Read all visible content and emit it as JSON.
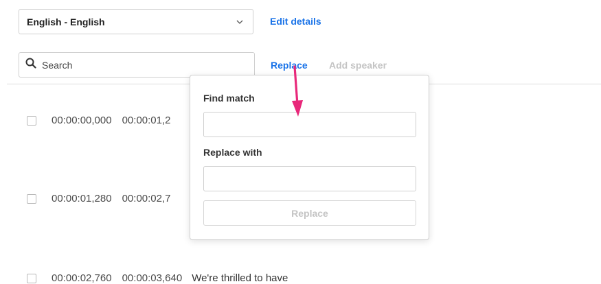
{
  "language_select": {
    "value": "English - English",
    "icon": "chevron-down-icon"
  },
  "edit_details_label": "Edit details",
  "search": {
    "placeholder": "Search",
    "value": "",
    "icon": "search-icon"
  },
  "toolbar": {
    "replace_label": "Replace",
    "add_speaker_label": "Add speaker"
  },
  "popover": {
    "find_label": "Find match",
    "find_value": "",
    "replace_label": "Replace with",
    "replace_value": "",
    "button_label": "Replace"
  },
  "rows": [
    {
      "start": "00:00:00,000",
      "end": "00:00:01,2",
      "text": ""
    },
    {
      "start": "00:00:01,280",
      "end": "00:00:02,7",
      "text": ""
    },
    {
      "start": "00:00:02,760",
      "end": "00:00:03,640",
      "text": "We're thrilled to have"
    }
  ],
  "colors": {
    "link": "#1a73e8",
    "disabled": "#c4c4c4",
    "annotation_arrow": "#e8287a"
  }
}
